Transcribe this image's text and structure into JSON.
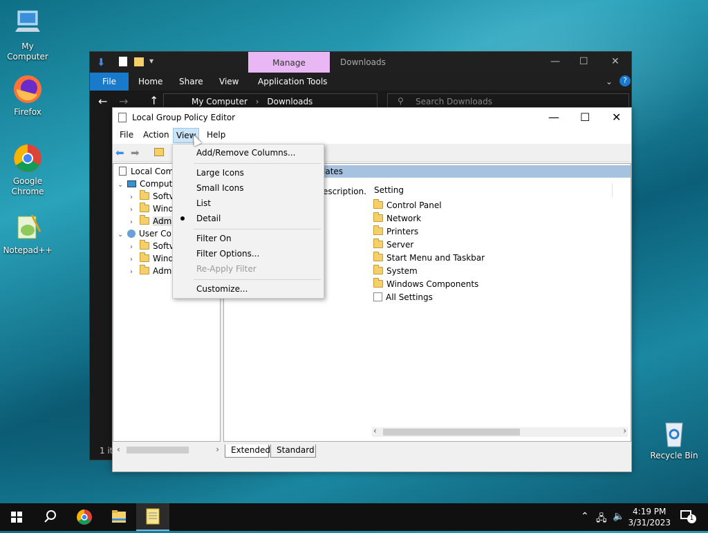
{
  "desktop": {
    "icons": [
      {
        "label": "My Computer"
      },
      {
        "label": "Firefox"
      },
      {
        "label": "Google Chrome"
      },
      {
        "label": "Notepad++"
      },
      {
        "label": "Recycle Bin"
      }
    ]
  },
  "explorer": {
    "contextual_tab": "Manage",
    "title": "Downloads",
    "ribbon_tabs": [
      "File",
      "Home",
      "Share",
      "View",
      "Application Tools"
    ],
    "breadcrumb": [
      "My Computer",
      "Downloads"
    ],
    "search_placeholder": "Search Downloads",
    "status": "1 it"
  },
  "gpo": {
    "title": "Local Group Policy Editor",
    "menu": [
      "File",
      "Action",
      "View",
      "Help"
    ],
    "tree": [
      {
        "label": "Local Comp",
        "level": 0
      },
      {
        "label": "Comput",
        "level": 1
      },
      {
        "label": "Softv",
        "level": 2
      },
      {
        "label": "Wind",
        "level": 2
      },
      {
        "label": "Adm",
        "level": 2
      },
      {
        "label": "User Co",
        "level": 1
      },
      {
        "label": "Softv",
        "level": 2
      },
      {
        "label": "Wind",
        "level": 2
      },
      {
        "label": "Adm",
        "level": 2
      }
    ],
    "header_fragment": "lates",
    "desc_fragment": "escription.",
    "setting_header": "Setting",
    "settings": [
      "Control Panel",
      "Network",
      "Printers",
      "Server",
      "Start Menu and Taskbar",
      "System",
      "Windows Components",
      "All Settings"
    ],
    "tabs": [
      "Extended",
      "Standard"
    ]
  },
  "view_menu": {
    "items": [
      {
        "label": "Add/Remove Columns...",
        "disabled": false
      },
      {
        "label": "Large Icons",
        "disabled": false
      },
      {
        "label": "Small Icons",
        "disabled": false
      },
      {
        "label": "List",
        "disabled": false
      },
      {
        "label": "Detail",
        "disabled": false,
        "checked": true
      },
      {
        "label": "Filter On",
        "disabled": false
      },
      {
        "label": "Filter Options...",
        "disabled": false
      },
      {
        "label": "Re-Apply Filter",
        "disabled": true
      },
      {
        "label": "Customize...",
        "disabled": false
      }
    ]
  },
  "taskbar": {
    "time": "4:19 PM",
    "date": "3/31/2023",
    "notification_count": "1"
  }
}
